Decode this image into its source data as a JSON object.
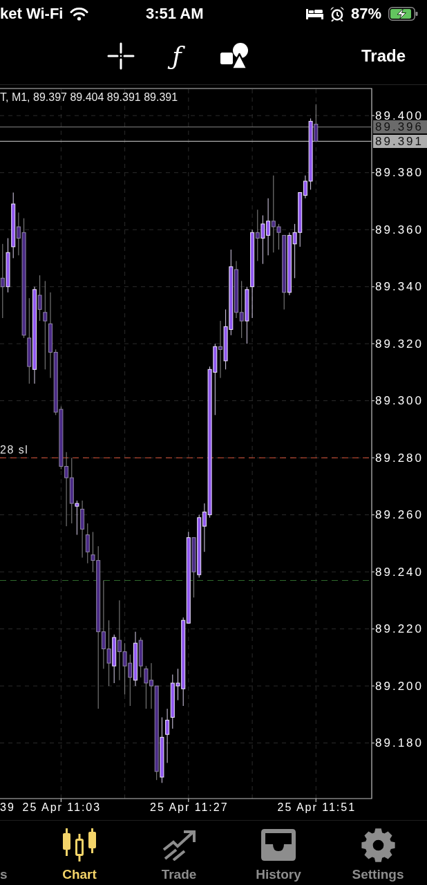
{
  "status_bar": {
    "carrier": "ket Wi-Fi",
    "time": "3:51 AM",
    "battery": "87%"
  },
  "toolbar": {
    "function_button": "ƒ",
    "trade_button": "Trade"
  },
  "chart": {
    "edge_time_label": "39",
    "chart_data": {
      "type": "candlestick",
      "title": "T, M1, 89.397 89.404 89.391 89.391",
      "grid": true,
      "categories": [
        null,
        null,
        null,
        null,
        null,
        null,
        null,
        null,
        null,
        null,
        null,
        "25 Apr 11:03",
        null,
        null,
        null,
        null,
        null,
        null,
        null,
        null,
        null,
        null,
        null,
        null,
        null,
        null,
        null,
        null,
        null,
        null,
        null,
        null,
        null,
        null,
        null,
        "25 Apr 11:27",
        null,
        null,
        null,
        null,
        null,
        null,
        null,
        null,
        null,
        null,
        null,
        null,
        null,
        null,
        null,
        null,
        null,
        null,
        null,
        null,
        null,
        null,
        null,
        "25 Apr 11:51",
        null,
        null,
        null,
        null,
        null,
        null,
        null,
        null,
        null,
        null
      ],
      "ohlc": [
        [
          89.343,
          89.355,
          89.329,
          89.34
        ],
        [
          89.34,
          89.357,
          89.338,
          89.352
        ],
        [
          89.354,
          89.373,
          89.35,
          89.369
        ],
        [
          89.361,
          89.366,
          89.351,
          89.357
        ],
        [
          89.359,
          89.364,
          89.322,
          89.323
        ],
        [
          89.322,
          89.336,
          89.306,
          89.312
        ],
        [
          89.311,
          89.34,
          89.306,
          89.339
        ],
        [
          89.337,
          89.344,
          89.328,
          89.332
        ],
        [
          89.331,
          89.342,
          89.311,
          89.328
        ],
        [
          89.327,
          89.338,
          89.308,
          89.317
        ],
        [
          89.317,
          89.318,
          89.295,
          89.296
        ],
        [
          89.297,
          89.298,
          89.276,
          89.277
        ],
        [
          89.277,
          89.282,
          89.256,
          89.273
        ],
        [
          89.273,
          89.28,
          89.257,
          89.264
        ],
        [
          89.263,
          89.265,
          89.253,
          89.264
        ],
        [
          89.262,
          89.265,
          89.245,
          89.255
        ],
        [
          89.253,
          89.257,
          89.243,
          89.247
        ],
        [
          89.246,
          89.254,
          89.24,
          89.244
        ],
        [
          89.244,
          89.249,
          89.192,
          89.219
        ],
        [
          89.219,
          89.237,
          89.206,
          89.213
        ],
        [
          89.213,
          89.223,
          89.2,
          89.208
        ],
        [
          89.207,
          89.218,
          89.201,
          89.217
        ],
        [
          89.216,
          89.23,
          89.202,
          89.212
        ],
        [
          89.212,
          89.215,
          89.197,
          89.207
        ],
        [
          89.208,
          89.211,
          89.193,
          89.203
        ],
        [
          89.202,
          89.219,
          89.2,
          89.215
        ],
        [
          89.216,
          89.217,
          89.203,
          89.207
        ],
        [
          89.206,
          89.207,
          89.192,
          89.201
        ],
        [
          89.202,
          89.208,
          89.192,
          89.2
        ],
        [
          89.2,
          89.2,
          89.167,
          89.17
        ],
        [
          89.168,
          89.189,
          89.166,
          89.182
        ],
        [
          89.183,
          89.192,
          89.173,
          89.188
        ],
        [
          89.189,
          89.204,
          89.185,
          89.201
        ],
        [
          89.2,
          89.206,
          89.195,
          89.201
        ],
        [
          89.199,
          89.224,
          89.193,
          89.223
        ],
        [
          89.222,
          89.254,
          89.222,
          89.252
        ],
        [
          89.252,
          89.252,
          89.231,
          89.24
        ],
        [
          89.239,
          89.26,
          89.238,
          89.259
        ],
        [
          89.256,
          89.264,
          89.247,
          89.261
        ],
        [
          89.26,
          89.312,
          89.259,
          89.311
        ],
        [
          89.31,
          89.32,
          89.295,
          89.319
        ],
        [
          89.319,
          89.328,
          89.308,
          89.318
        ],
        [
          89.314,
          89.332,
          89.311,
          89.326
        ],
        [
          89.325,
          89.353,
          89.323,
          89.347
        ],
        [
          89.346,
          89.349,
          89.329,
          89.331
        ],
        [
          89.331,
          89.342,
          89.322,
          89.328
        ],
        [
          89.328,
          89.34,
          89.32,
          89.339
        ],
        [
          89.34,
          89.36,
          89.329,
          89.359
        ],
        [
          89.359,
          89.367,
          89.349,
          89.357
        ],
        [
          89.357,
          89.365,
          89.348,
          89.362
        ],
        [
          89.358,
          89.371,
          89.351,
          89.363
        ],
        [
          89.363,
          89.379,
          89.352,
          89.361
        ],
        [
          89.361,
          89.362,
          89.353,
          89.359
        ],
        [
          89.358,
          89.358,
          89.332,
          89.338
        ],
        [
          89.338,
          89.359,
          89.337,
          89.358
        ],
        [
          89.355,
          89.362,
          89.343,
          89.359
        ],
        [
          89.359,
          89.373,
          89.354,
          89.373
        ],
        [
          89.372,
          89.379,
          89.371,
          89.377
        ],
        [
          89.377,
          89.399,
          89.374,
          89.398
        ],
        [
          89.397,
          89.404,
          89.391,
          89.391
        ],
        null,
        null,
        null,
        null,
        null,
        null,
        null,
        null,
        null,
        null
      ],
      "ylim": [
        89.1605,
        89.4095
      ],
      "yticks": [
        {
          "value": 89.4,
          "label": "89.400"
        },
        {
          "value": 89.38,
          "label": "89.380"
        },
        {
          "value": 89.36,
          "label": "89.360"
        },
        {
          "value": 89.34,
          "label": "89.340"
        },
        {
          "value": 89.32,
          "label": "89.320"
        },
        {
          "value": 89.3,
          "label": "89.300"
        },
        {
          "value": 89.28,
          "label": "89.280"
        },
        {
          "value": 89.26,
          "label": "89.260"
        },
        {
          "value": 89.24,
          "label": "89.240"
        },
        {
          "value": 89.22,
          "label": "89.220"
        },
        {
          "value": 89.2,
          "label": "89.200"
        },
        {
          "value": 89.18,
          "label": "89.180"
        }
      ],
      "ref_lines": [
        {
          "axis": "y",
          "value": 89.396,
          "label": "89.396",
          "color": "#6b6b6b"
        },
        {
          "axis": "y",
          "value": 89.391,
          "label": "89.391",
          "color": "#adadad"
        },
        {
          "axis": "y",
          "value": 89.28,
          "label": "28 sl",
          "color": "#b3452f"
        },
        {
          "axis": "y",
          "value": 89.237,
          "color": "#2f6a2c"
        }
      ]
    }
  },
  "tabs": [
    {
      "label": "s",
      "selected": false
    },
    {
      "label": "Chart",
      "selected": true
    },
    {
      "label": "Trade",
      "selected": false
    },
    {
      "label": "History",
      "selected": false
    },
    {
      "label": "Settings",
      "selected": false
    }
  ]
}
